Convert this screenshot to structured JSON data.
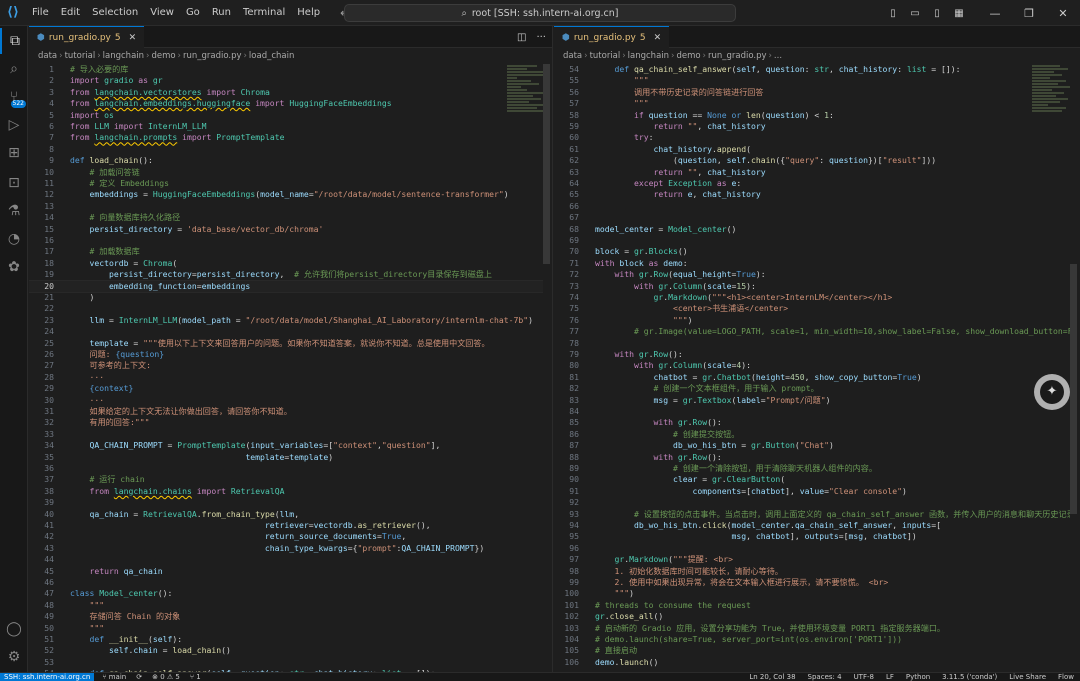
{
  "menu": [
    "File",
    "Edit",
    "Selection",
    "View",
    "Go",
    "Run",
    "Terminal",
    "Help"
  ],
  "title": "root [SSH: ssh.intern-ai.org.cn]",
  "activity_badge": "522",
  "left": {
    "tab": {
      "name": "run_gradio.py",
      "mod": "5"
    },
    "breadcrumb": [
      "data",
      "tutorial",
      "langchain",
      "demo",
      "run_gradio.py",
      "load_chain"
    ],
    "lines": [
      {
        "n": "1",
        "h": "<span class=\"c\"># 导入必要的库</span>"
      },
      {
        "n": "2",
        "h": "<span class=\"k\">import</span> <span class=\"t\">gradio</span> <span class=\"k\">as</span> <span class=\"t\">gr</span>"
      },
      {
        "n": "3",
        "h": "<span class=\"k\">from</span> <span class=\"t sq\">langchain.vectorstores</span> <span class=\"k\">import</span> <span class=\"t\">Chroma</span>"
      },
      {
        "n": "4",
        "h": "<span class=\"k\">from</span> <span class=\"t sq\">langchain.embeddings.huggingface</span> <span class=\"k\">import</span> <span class=\"t\">HuggingFaceEmbeddings</span>"
      },
      {
        "n": "5",
        "h": "<span class=\"k\">import</span> <span class=\"t\">os</span>"
      },
      {
        "n": "6",
        "h": "<span class=\"k\">from</span> <span class=\"t\">LLM</span> <span class=\"k\">import</span> <span class=\"t\">InternLM_LLM</span>"
      },
      {
        "n": "7",
        "h": "<span class=\"k\">from</span> <span class=\"t sq\">langchain.prompts</span> <span class=\"k\">import</span> <span class=\"t\">PromptTemplate</span>"
      },
      {
        "n": "8",
        "h": ""
      },
      {
        "n": "9",
        "h": "<span class=\"b\">def</span> <span class=\"f\">load_chain</span>():"
      },
      {
        "n": "10",
        "h": "    <span class=\"c\"># 加载问答链</span>"
      },
      {
        "n": "11",
        "h": "    <span class=\"c\"># 定义 Embeddings</span>"
      },
      {
        "n": "12",
        "h": "    <span class=\"v\">embeddings</span> = <span class=\"t\">HuggingFaceEmbeddings</span>(<span class=\"v\">model_name</span>=<span class=\"s\">\"/root/data/model/sentence-transformer\"</span>)"
      },
      {
        "n": "13",
        "h": ""
      },
      {
        "n": "14",
        "h": "    <span class=\"c\"># 向量数据库持久化路径</span>"
      },
      {
        "n": "15",
        "h": "    <span class=\"v\">persist_directory</span> = <span class=\"s\">'data_base/vector_db/chroma'</span>"
      },
      {
        "n": "16",
        "h": ""
      },
      {
        "n": "17",
        "h": "    <span class=\"c\"># 加载数据库</span>"
      },
      {
        "n": "18",
        "h": "    <span class=\"v\">vectordb</span> = <span class=\"t\">Chroma</span>("
      },
      {
        "n": "19",
        "h": "        <span class=\"v\">persist_directory</span>=<span class=\"v\">persist_directory</span>,  <span class=\"c\"># 允许我们将persist_directory目录保存到磁盘上</span>"
      },
      {
        "n": "20",
        "h": "        <span class=\"v\">embedding_function</span>=<span class=\"v\">embeddings</span>",
        "cur": true
      },
      {
        "n": "21",
        "h": "    )"
      },
      {
        "n": "22",
        "h": ""
      },
      {
        "n": "23",
        "h": "    <span class=\"v\">llm</span> = <span class=\"t\">InternLM_LLM</span>(<span class=\"v\">model_path</span> = <span class=\"s\">\"/root/data/model/Shanghai_AI_Laboratory/internlm-chat-7b\"</span>)"
      },
      {
        "n": "24",
        "h": ""
      },
      {
        "n": "25",
        "h": "    <span class=\"v\">template</span> = <span class=\"s\">\"\"\"使用以下上下文来回答用户的问题。如果你不知道答案，就说你不知道。总是使用中文回答。</span>"
      },
      {
        "n": "26",
        "h": "<span class=\"s\">    问题: </span><span class=\"b\">{question}</span>"
      },
      {
        "n": "27",
        "h": "<span class=\"s\">    可参考的上下文:</span>"
      },
      {
        "n": "28",
        "h": "<span class=\"s\">    ···</span>"
      },
      {
        "n": "29",
        "h": "    <span class=\"b\">{context}</span>"
      },
      {
        "n": "30",
        "h": "<span class=\"s\">    ···</span>"
      },
      {
        "n": "31",
        "h": "<span class=\"s\">    如果给定的上下文无法让你做出回答，请回答你不知道。</span>"
      },
      {
        "n": "32",
        "h": "<span class=\"s\">    有用的回答:\"\"\"</span>"
      },
      {
        "n": "33",
        "h": ""
      },
      {
        "n": "34",
        "h": "    <span class=\"v\">QA_CHAIN_PROMPT</span> = <span class=\"t\">PromptTemplate</span>(<span class=\"v\">input_variables</span>=[<span class=\"s\">\"context\"</span>,<span class=\"s\">\"question\"</span>],"
      },
      {
        "n": "35",
        "h": "                                    <span class=\"v\">template</span>=<span class=\"v\">template</span>)"
      },
      {
        "n": "36",
        "h": ""
      },
      {
        "n": "37",
        "h": "    <span class=\"c\"># 运行 chain</span>"
      },
      {
        "n": "38",
        "h": "    <span class=\"k\">from</span> <span class=\"t sq\">langchain.chains</span> <span class=\"k\">import</span> <span class=\"t\">RetrievalQA</span>"
      },
      {
        "n": "39",
        "h": ""
      },
      {
        "n": "40",
        "h": "    <span class=\"v\">qa_chain</span> = <span class=\"t\">RetrievalQA</span>.<span class=\"f\">from_chain_type</span>(<span class=\"v\">llm</span>,"
      },
      {
        "n": "41",
        "h": "                                        <span class=\"v\">retriever</span>=<span class=\"v\">vectordb</span>.<span class=\"f\">as_retriever</span>(),"
      },
      {
        "n": "42",
        "h": "                                        <span class=\"v\">return_source_documents</span>=<span class=\"b\">True</span>,"
      },
      {
        "n": "43",
        "h": "                                        <span class=\"v\">chain_type_kwargs</span>={<span class=\"s\">\"prompt\"</span>:<span class=\"v\">QA_CHAIN_PROMPT</span>})"
      },
      {
        "n": "44",
        "h": ""
      },
      {
        "n": "45",
        "h": "    <span class=\"k\">return</span> <span class=\"v\">qa_chain</span>"
      },
      {
        "n": "46",
        "h": ""
      },
      {
        "n": "47",
        "h": "<span class=\"b\">class</span> <span class=\"t\">Model_center</span>():"
      },
      {
        "n": "48",
        "h": "    <span class=\"s\">\"\"\"</span>"
      },
      {
        "n": "49",
        "h": "<span class=\"s\">    存储问答 Chain 的对象</span>"
      },
      {
        "n": "50",
        "h": "    <span class=\"s\">\"\"\"</span>"
      },
      {
        "n": "51",
        "h": "    <span class=\"b\">def</span> <span class=\"f\">__init__</span>(<span class=\"v\">self</span>):"
      },
      {
        "n": "52",
        "h": "        <span class=\"v\">self</span>.<span class=\"v\">chain</span> = <span class=\"f\">load_chain</span>()"
      },
      {
        "n": "53",
        "h": ""
      },
      {
        "n": "54",
        "h": "    <span class=\"b\">def</span> <span class=\"f\">qa_chain_self_answer</span>(<span class=\"v\">self</span>, <span class=\"v\">question</span>: <span class=\"t\">str</span>, <span class=\"v\">chat_history</span>: <span class=\"t\">list</span> = []):"
      }
    ]
  },
  "right": {
    "tab": {
      "name": "run_gradio.py",
      "mod": "5"
    },
    "breadcrumb": [
      "data",
      "tutorial",
      "langchain",
      "demo",
      "run_gradio.py",
      "..."
    ],
    "lines": [
      {
        "n": "54",
        "h": "    <span class=\"b\">def</span> <span class=\"f\">qa_chain_self_answer</span>(<span class=\"v\">self</span>, <span class=\"v\">question</span>: <span class=\"t\">str</span>, <span class=\"v\">chat_history</span>: <span class=\"t\">list</span> = []):"
      },
      {
        "n": "55",
        "h": "        <span class=\"s\">\"\"\"</span>"
      },
      {
        "n": "56",
        "h": "<span class=\"s\">        调用不带历史记录的问答链进行回答</span>"
      },
      {
        "n": "57",
        "h": "        <span class=\"s\">\"\"\"</span>"
      },
      {
        "n": "58",
        "h": "        <span class=\"k\">if</span> <span class=\"v\">question</span> == <span class=\"b\">None</span> <span class=\"b\">or</span> <span class=\"f\">len</span>(<span class=\"v\">question</span>) &lt; <span class=\"n\">1</span>:"
      },
      {
        "n": "59",
        "h": "            <span class=\"k\">return</span> <span class=\"s\">\"\"</span>, <span class=\"v\">chat_history</span>"
      },
      {
        "n": "60",
        "h": "        <span class=\"k\">try</span>:"
      },
      {
        "n": "61",
        "h": "            <span class=\"v\">chat_history</span>.<span class=\"f\">append</span>("
      },
      {
        "n": "62",
        "h": "                (<span class=\"v\">question</span>, <span class=\"v\">self</span>.<span class=\"f\">chain</span>({<span class=\"s\">\"query\"</span>: <span class=\"v\">question</span>})[<span class=\"s\">\"result\"</span>]))"
      },
      {
        "n": "63",
        "h": "            <span class=\"k\">return</span> <span class=\"s\">\"\"</span>, <span class=\"v\">chat_history</span>"
      },
      {
        "n": "64",
        "h": "        <span class=\"k\">except</span> <span class=\"t\">Exception</span> <span class=\"k\">as</span> <span class=\"v\">e</span>:"
      },
      {
        "n": "65",
        "h": "            <span class=\"k\">return</span> <span class=\"v\">e</span>, <span class=\"v\">chat_history</span>"
      },
      {
        "n": "66",
        "h": ""
      },
      {
        "n": "67",
        "h": ""
      },
      {
        "n": "68",
        "h": "<span class=\"v\">model_center</span> = <span class=\"t\">Model_center</span>()"
      },
      {
        "n": "69",
        "h": ""
      },
      {
        "n": "70",
        "h": "<span class=\"v\">block</span> = <span class=\"t\">gr</span>.<span class=\"t\">Blocks</span>()"
      },
      {
        "n": "71",
        "h": "<span class=\"k\">with</span> <span class=\"v\">block</span> <span class=\"k\">as</span> <span class=\"v\">demo</span>:"
      },
      {
        "n": "72",
        "h": "    <span class=\"k\">with</span> <span class=\"t\">gr</span>.<span class=\"t\">Row</span>(<span class=\"v\">equal_height</span>=<span class=\"b\">True</span>):"
      },
      {
        "n": "73",
        "h": "        <span class=\"k\">with</span> <span class=\"t\">gr</span>.<span class=\"t\">Column</span>(<span class=\"v\">scale</span>=<span class=\"n\">15</span>):"
      },
      {
        "n": "74",
        "h": "            <span class=\"t\">gr</span>.<span class=\"t\">Markdown</span>(<span class=\"s\">\"\"\"&lt;h1&gt;&lt;center&gt;InternLM&lt;/center&gt;&lt;/h1&gt;</span>"
      },
      {
        "n": "75",
        "h": "<span class=\"s\">                &lt;center&gt;书生浦语&lt;/center&gt;</span>"
      },
      {
        "n": "76",
        "h": "<span class=\"s\">                \"\"\"</span>)"
      },
      {
        "n": "77",
        "h": "        <span class=\"c\"># gr.Image(value=LOGO_PATH, scale=1, min_width=10,show_label=False, show_download_button=False)</span>"
      },
      {
        "n": "78",
        "h": ""
      },
      {
        "n": "79",
        "h": "    <span class=\"k\">with</span> <span class=\"t\">gr</span>.<span class=\"t\">Row</span>():"
      },
      {
        "n": "80",
        "h": "        <span class=\"k\">with</span> <span class=\"t\">gr</span>.<span class=\"t\">Column</span>(<span class=\"v\">scale</span>=<span class=\"n\">4</span>):"
      },
      {
        "n": "81",
        "h": "            <span class=\"v\">chatbot</span> = <span class=\"t\">gr</span>.<span class=\"t\">Chatbot</span>(<span class=\"v\">height</span>=<span class=\"n\">450</span>, <span class=\"v\">show_copy_button</span>=<span class=\"b\">True</span>)"
      },
      {
        "n": "82",
        "h": "            <span class=\"c\"># 创建一个文本框组件，用于输入 prompt。</span>"
      },
      {
        "n": "83",
        "h": "            <span class=\"v\">msg</span> = <span class=\"t\">gr</span>.<span class=\"t\">Textbox</span>(<span class=\"v\">label</span>=<span class=\"s\">\"Prompt/问题\"</span>)"
      },
      {
        "n": "84",
        "h": ""
      },
      {
        "n": "85",
        "h": "            <span class=\"k\">with</span> <span class=\"t\">gr</span>.<span class=\"t\">Row</span>():"
      },
      {
        "n": "86",
        "h": "                <span class=\"c\"># 创建提交按钮。</span>"
      },
      {
        "n": "87",
        "h": "                <span class=\"v\">db_wo_his_btn</span> = <span class=\"t\">gr</span>.<span class=\"t\">Button</span>(<span class=\"s\">\"Chat\"</span>)"
      },
      {
        "n": "88",
        "h": "            <span class=\"k\">with</span> <span class=\"t\">gr</span>.<span class=\"t\">Row</span>():"
      },
      {
        "n": "89",
        "h": "                <span class=\"c\"># 创建一个清除按钮，用于清除聊天机器人组件的内容。</span>"
      },
      {
        "n": "90",
        "h": "                <span class=\"v\">clear</span> = <span class=\"t\">gr</span>.<span class=\"t\">ClearButton</span>("
      },
      {
        "n": "91",
        "h": "                    <span class=\"v\">components</span>=[<span class=\"v\">chatbot</span>], <span class=\"v\">value</span>=<span class=\"s\">\"Clear console\"</span>)"
      },
      {
        "n": "92",
        "h": ""
      },
      {
        "n": "93",
        "h": "        <span class=\"c\"># 设置按钮的点击事件。当点击时，调用上面定义的 qa_chain_self_answer 函数，并传入用户的消息和聊天历史记录</span>"
      },
      {
        "n": "94",
        "h": "        <span class=\"v\">db_wo_his_btn</span>.<span class=\"f\">click</span>(<span class=\"v\">model_center</span>.<span class=\"v\">qa_chain_self_answer</span>, <span class=\"v\">inputs</span>=["
      },
      {
        "n": "95",
        "h": "                            <span class=\"v\">msg</span>, <span class=\"v\">chatbot</span>], <span class=\"v\">outputs</span>=[<span class=\"v\">msg</span>, <span class=\"v\">chatbot</span>])"
      },
      {
        "n": "96",
        "h": ""
      },
      {
        "n": "97",
        "h": "    <span class=\"t\">gr</span>.<span class=\"t\">Markdown</span>(<span class=\"s\">\"\"\"提醒: &lt;br&gt;</span>"
      },
      {
        "n": "98",
        "h": "<span class=\"s\">    1. 初始化数据库时间可能较长，请耐心等待。</span>"
      },
      {
        "n": "99",
        "h": "<span class=\"s\">    2. 使用中如果出现异常，将会在文本输入框进行展示，请不要惊慌。 &lt;br&gt;</span>"
      },
      {
        "n": "100",
        "h": "<span class=\"s\">    \"\"\"</span>)"
      },
      {
        "n": "101",
        "h": "<span class=\"c\"># threads to consume the request</span>"
      },
      {
        "n": "102",
        "h": "<span class=\"t\">gr</span>.<span class=\"f\">close_all</span>()"
      },
      {
        "n": "103",
        "h": "<span class=\"c\"># 启动新的 Gradio 应用，设置分享功能为 True，并使用环境变量 PORT1 指定服务器端口。</span>"
      },
      {
        "n": "104",
        "h": "<span class=\"c\"># demo.launch(share=True, server_port=int(os.environ['PORT1']))</span>"
      },
      {
        "n": "105",
        "h": "<span class=\"c\"># 直接启动</span>"
      },
      {
        "n": "106",
        "h": "<span class=\"v\">demo</span>.<span class=\"f\">launch</span>()"
      }
    ]
  },
  "status": {
    "remote": "SSH: ssh.intern-ai.org.cn",
    "branch": "main",
    "sync": "⟳",
    "problems": "⊗ 0 ⚠ 5",
    "ports": "⑂ 1",
    "position": "Ln 20, Col 38",
    "spaces": "Spaces: 4",
    "encoding": "UTF-8",
    "eol": "LF",
    "language": "Python",
    "interpreter": "3.11.5 ('conda')",
    "live": "Live Share",
    "notif": "Flow"
  }
}
